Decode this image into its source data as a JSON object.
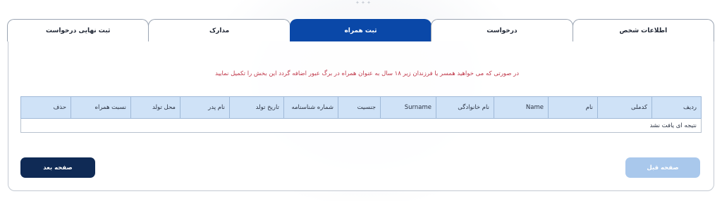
{
  "tabs": [
    {
      "label": "اطلاعات شخص",
      "active": false
    },
    {
      "label": "درخواست",
      "active": false
    },
    {
      "label": "ثبت همراه",
      "active": true
    },
    {
      "label": "مدارک",
      "active": false
    },
    {
      "label": "ثبت نهایی درخواست",
      "active": false
    }
  ],
  "notice": "در صورتی که می خواهید همسر یا فرزندان زیر ۱۸ سال به عنوان همراه در برگ عبور اضافه گردد این بخش را تکمیل نمایید",
  "table": {
    "headers": [
      "ردیف",
      "کدملی",
      "نام",
      "Name",
      "نام خانوادگی",
      "Surname",
      "جنسیت",
      "شماره شناسنامه",
      "تاریخ تولد",
      "نام پدر",
      "محل تولد",
      "نسبت همراه",
      "حذف"
    ],
    "empty_message": "نتیجه ای یافت نشد"
  },
  "buttons": {
    "prev": "صفحه قبل",
    "next": "صفحه بعد"
  },
  "colors": {
    "active_tab": "#0a48a8",
    "notice_text": "#c0384a",
    "header_bg": "#cfe2f7",
    "next_button": "#0f2a55",
    "prev_button": "#a9c8ec"
  }
}
